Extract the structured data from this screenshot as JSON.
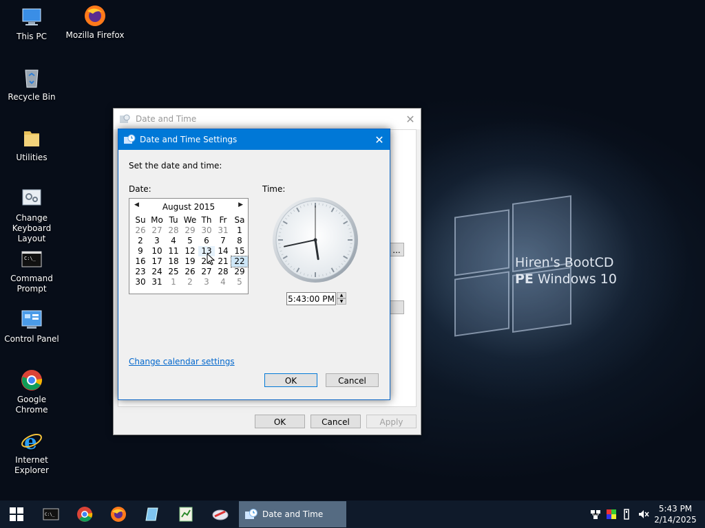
{
  "desktop": {
    "icons": [
      {
        "label": "This PC",
        "icon": "this-pc-icon"
      },
      {
        "label": "Mozilla Firefox",
        "icon": "firefox-icon"
      },
      {
        "label": "Recycle Bin",
        "icon": "recycle-bin-icon"
      },
      {
        "label": "Utilities",
        "icon": "folder-icon"
      },
      {
        "label": "Change Keyboard Layout",
        "icon": "keyboard-settings-icon"
      },
      {
        "label": "Command Prompt",
        "icon": "command-prompt-icon"
      },
      {
        "label": "Control Panel",
        "icon": "control-panel-icon"
      },
      {
        "label": "Google Chrome",
        "icon": "chrome-icon"
      },
      {
        "label": "Internet Explorer",
        "icon": "internet-explorer-icon"
      }
    ],
    "wallpaper": {
      "line1": "Hiren's BootCD",
      "line2_bold": "PE",
      "line2_rest": " Windows 10"
    }
  },
  "back_window": {
    "title": "Date and Time",
    "buttons": {
      "ok": "OK",
      "cancel": "Cancel",
      "apply": "Apply"
    },
    "partial_button": "..."
  },
  "dialog": {
    "title": "Date and Time Settings",
    "instruction": "Set the date and time:",
    "date_label": "Date:",
    "time_label": "Time:",
    "calendar": {
      "month": "August 2015",
      "weekdays": [
        "Su",
        "Mo",
        "Tu",
        "We",
        "Th",
        "Fr",
        "Sa"
      ],
      "weeks": [
        [
          "26",
          "27",
          "28",
          "29",
          "30",
          "31",
          "1"
        ],
        [
          "2",
          "3",
          "4",
          "5",
          "6",
          "7",
          "8"
        ],
        [
          "9",
          "10",
          "11",
          "12",
          "13",
          "14",
          "15"
        ],
        [
          "16",
          "17",
          "18",
          "19",
          "20",
          "21",
          "22"
        ],
        [
          "23",
          "24",
          "25",
          "26",
          "27",
          "28",
          "29"
        ],
        [
          "30",
          "31",
          "1",
          "2",
          "3",
          "4",
          "5"
        ]
      ],
      "selected_day": "22",
      "hovered_day": "13"
    },
    "time_value": "5:43:00 PM",
    "clock": {
      "hour": 5,
      "minute": 43,
      "second": 0
    },
    "change_calendar_link": "Change calendar settings",
    "ok_label": "OK",
    "cancel_label": "Cancel"
  },
  "taskbar": {
    "pinned": [
      "command-prompt-icon",
      "chrome-icon",
      "firefox-icon",
      "notepad-icon",
      "spreadsheet-icon",
      "tool-icon"
    ],
    "active_task": "Date and Time",
    "tray_icons": [
      "network-icon",
      "color-icon",
      "usb-icon",
      "volume-muted-icon"
    ],
    "time": "5:43 PM",
    "date": "2/14/2025"
  },
  "colors": {
    "accent": "#0078d7",
    "taskbar": "#0f1a2a",
    "active_task": "#556b82"
  }
}
